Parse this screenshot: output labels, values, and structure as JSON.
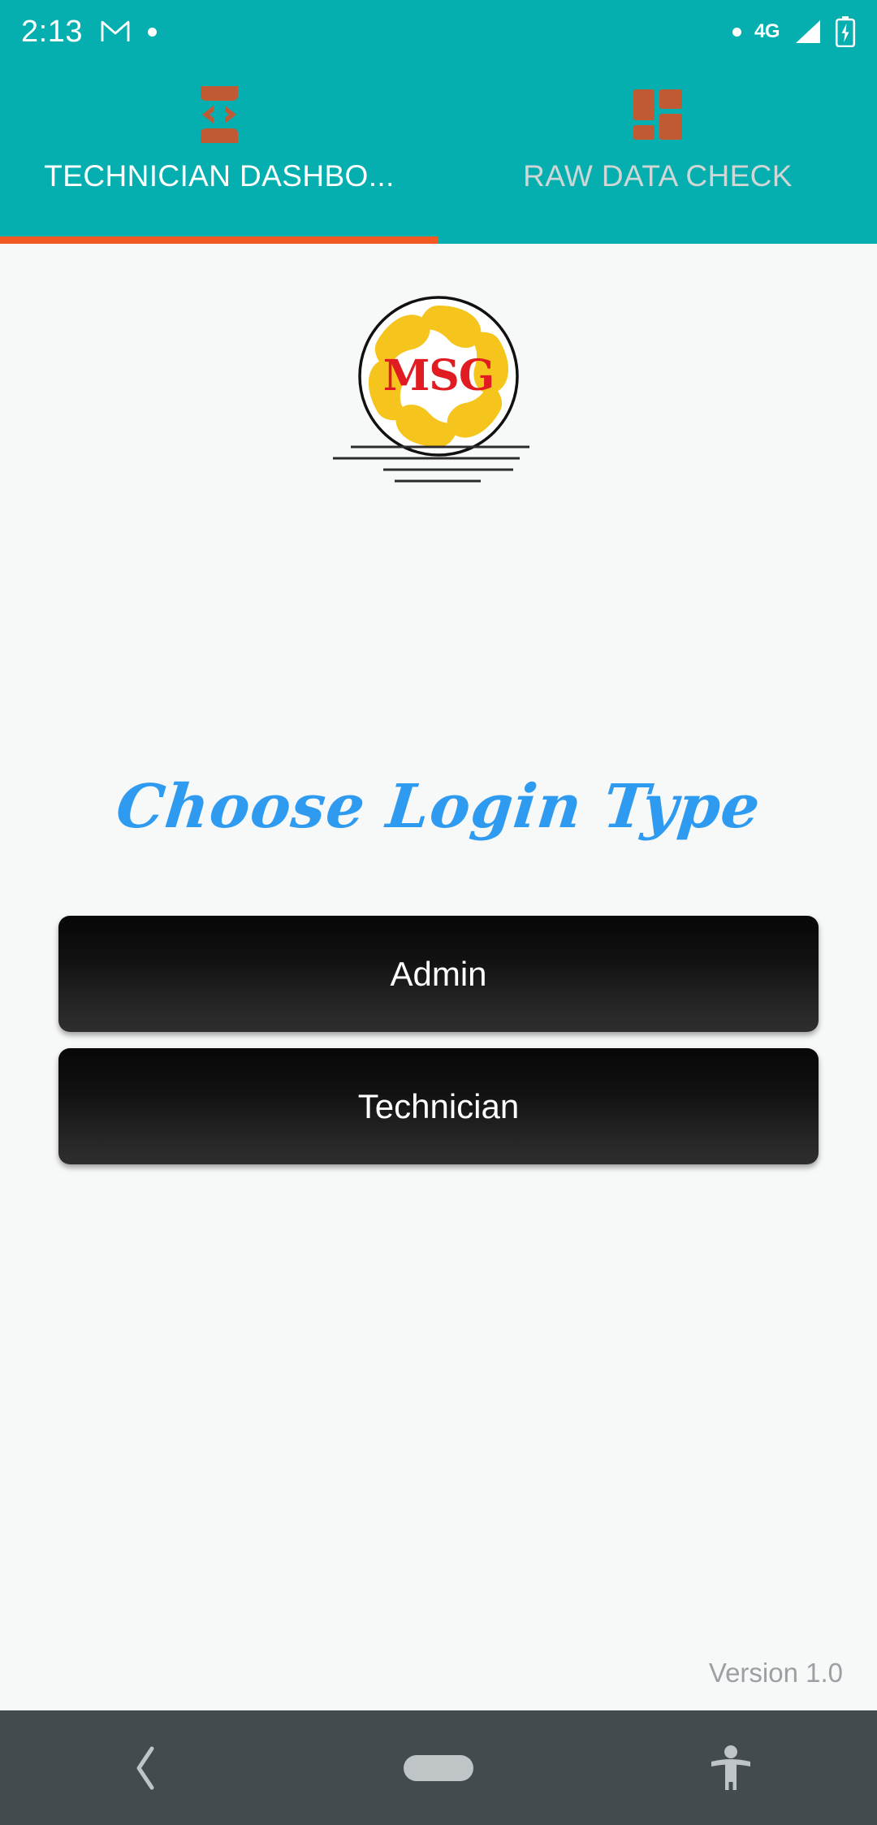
{
  "status_bar": {
    "time": "2:13",
    "icons_left": [
      "gmail-icon",
      "notification-dot"
    ],
    "network_label": "4G",
    "icons_right": [
      "notification-dot",
      "signal-icon",
      "battery-charging-icon"
    ],
    "background_color": "#05AFAF",
    "foreground_color": "#FFFFFF"
  },
  "tab_bar": {
    "background_color": "#05AFAF",
    "indicator_color": "#F15A24",
    "icon_color": "#C05A35",
    "active_index": 0,
    "tabs": [
      {
        "label": "TECHNICIAN DASHBO...",
        "icon": "developer-mode-icon",
        "active": true
      },
      {
        "label": "RAW DATA CHECK",
        "icon": "dashboard-grid-icon",
        "active": false
      }
    ]
  },
  "logo": {
    "alt": "MSG logo",
    "text": "MSG",
    "text_color": "#E01B22",
    "petal_color": "#F5C51E",
    "outline_color": "#111111",
    "line_count": 4
  },
  "main": {
    "heading": "Choose Login Type",
    "heading_color": "#2E9BF0",
    "buttons": [
      {
        "label": "Admin"
      },
      {
        "label": "Technician"
      }
    ]
  },
  "footer": {
    "version": "Version 1.0",
    "version_color": "#9AA0A3"
  },
  "nav_bar": {
    "background_color": "#434B4F",
    "items": [
      {
        "name": "back",
        "icon": "chevron-left-icon"
      },
      {
        "name": "home",
        "icon": "home-pill-icon"
      },
      {
        "name": "accessibility",
        "icon": "accessibility-icon"
      }
    ]
  }
}
